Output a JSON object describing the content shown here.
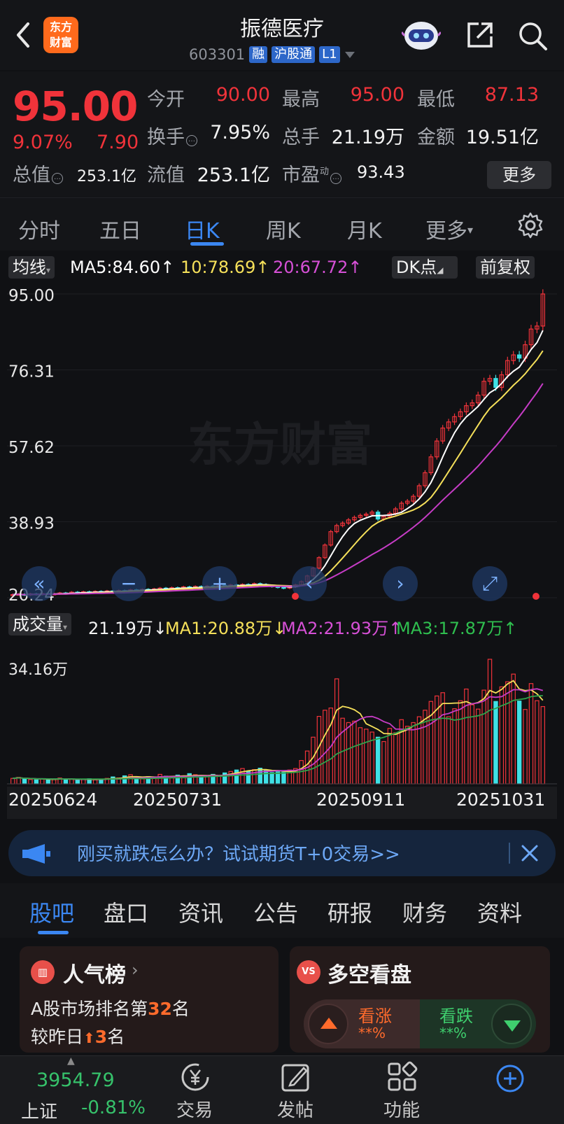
{
  "header": {
    "logo_text_top": "东方",
    "logo_text_bottom": "财富",
    "stock_name": "振德医疗",
    "stock_code": "603301",
    "tag_margin": "融",
    "tag_connect": "沪股通",
    "tag_level": "L1"
  },
  "quote": {
    "price": "95.00",
    "change_pct": "9.07%",
    "change_abs": "7.90",
    "open_label": "今开",
    "open": "90.00",
    "high_label": "最高",
    "high": "95.00",
    "low_label": "最低",
    "low": "87.13",
    "turnover_label": "换手",
    "turnover": "7.95%",
    "volume_label": "总手",
    "volume": "21.19万",
    "amount_label": "金额",
    "amount": "19.51亿",
    "mktcap_label": "总值",
    "mktcap": "253.1亿",
    "float_label": "流值",
    "float_cap": "253.1亿",
    "pe_label": "市盈",
    "pe_sup": "动",
    "pe": "93.43",
    "more_label": "更多"
  },
  "period_tabs": [
    "分时",
    "五日",
    "日K",
    "周K",
    "月K",
    "更多"
  ],
  "active_period": "日K",
  "ma_bar": {
    "selector": "均线",
    "ma5": "MA5:84.60↑",
    "ma10": "10:78.69↑",
    "ma20": "20:67.72↑",
    "dk_label": "DK点",
    "adjust_label": "前复权"
  },
  "colors": {
    "up": "#f0333a",
    "down": "#3fe1e6",
    "ma5": "#ffffff",
    "ma10": "#f5e05a",
    "ma20": "#c63cc6",
    "vol_ma3": "#2fa24a",
    "accent": "#3b87f2"
  },
  "chart_data": {
    "type": "candlestick",
    "y_ticks": [
      "95.00",
      "76.31",
      "57.62",
      "38.93",
      "20.24"
    ],
    "ylim": [
      20.24,
      95.0
    ],
    "watermark": "东方财富",
    "x_ticks": [
      "20250624",
      "20250731",
      "20250911",
      "20251031"
    ],
    "closes": [
      21.0,
      21.1,
      20.9,
      21.2,
      21.0,
      21.3,
      21.1,
      21.2,
      21.4,
      21.3,
      21.6,
      21.4,
      21.7,
      21.5,
      21.8,
      21.6,
      21.9,
      21.7,
      22.0,
      21.9,
      22.2,
      22.0,
      22.3,
      22.1,
      22.4,
      22.6,
      22.3,
      22.7,
      22.5,
      22.9,
      22.6,
      23.0,
      22.8,
      23.1,
      22.9,
      23.3,
      23.0,
      23.4,
      23.2,
      23.5,
      23.3,
      23.7,
      23.5,
      23.2,
      23.0,
      22.8,
      22.6,
      22.9,
      23.4,
      24.2,
      25.6,
      27.5,
      30.1,
      33.2,
      36.5,
      38.0,
      38.6,
      39.4,
      40.0,
      40.5,
      40.8,
      41.3,
      39.6,
      40.2,
      41.0,
      42.1,
      43.5,
      44.0,
      45.2,
      47.8,
      51.0,
      54.9,
      58.8,
      62.0,
      63.5,
      64.8,
      66.0,
      67.5,
      68.2,
      70.1,
      73.5,
      74.2,
      72.0,
      75.1,
      78.6,
      80.0,
      79.2,
      82.5,
      86.36,
      87.1,
      95.0
    ],
    "volume_ticks": [
      "34.16万"
    ],
    "volume_ylim": [
      0,
      34.16
    ],
    "volumes": [
      1.5,
      1.8,
      1.3,
      1.2,
      1.1,
      1.4,
      1.3,
      1.2,
      1.6,
      1.1,
      1.3,
      1.0,
      1.2,
      1.4,
      1.1,
      1.3,
      1.5,
      1.9,
      1.6,
      2.2,
      2.5,
      1.6,
      1.4,
      2.0,
      1.8,
      2.6,
      2.1,
      1.7,
      2.4,
      2.0,
      2.8,
      2.5,
      1.9,
      2.2,
      2.6,
      2.1,
      3.0,
      3.4,
      3.8,
      4.2,
      3.5,
      3.9,
      4.3,
      3.6,
      3.1,
      3.3,
      3.2,
      3.8,
      4.2,
      6.4,
      9.0,
      12.8,
      18.5,
      20.2,
      20.8,
      28.8,
      18.0,
      16.8,
      17.2,
      15.4,
      15.0,
      14.2,
      12.8,
      11.6,
      15.2,
      14.0,
      17.6,
      15.8,
      16.8,
      18.4,
      20.2,
      22.6,
      24.1,
      25.0,
      18.4,
      20.6,
      22.8,
      26.0,
      21.7,
      20.5,
      25.7,
      34.16,
      22.6,
      26.6,
      28.0,
      30.1,
      22.7,
      20.4,
      27.5,
      22.8,
      21.19
    ]
  },
  "vol_bar": {
    "selector": "成交量",
    "vol": "21.19万↓",
    "ma1": "MA1:20.88万↓",
    "ma2": "MA2:21.93万↑",
    "ma3": "MA3:17.87万↑"
  },
  "banner": {
    "text": "刚买就跌怎么办？试试期货T+0交易>>"
  },
  "section_tabs": [
    "股吧",
    "盘口",
    "资讯",
    "公告",
    "研报",
    "财务",
    "资料"
  ],
  "popularity_card": {
    "title": "人气榜",
    "line1_prefix": "A股市场排名第",
    "rank": "32",
    "line1_suffix": "名",
    "line2_prefix": "较昨日",
    "rank_change": "3",
    "line2_suffix": "名"
  },
  "sentiment_card": {
    "icon_text": "VS",
    "title": "多空看盘",
    "bull_label": "看涨",
    "bull_pct": "**%",
    "bear_label": "看跌",
    "bear_pct": "**%"
  },
  "bottom_nav": {
    "index_value": "3954.79",
    "index_name": "上证",
    "index_change": "-0.81%",
    "trade": "交易",
    "post": "发帖",
    "function": "功能"
  }
}
